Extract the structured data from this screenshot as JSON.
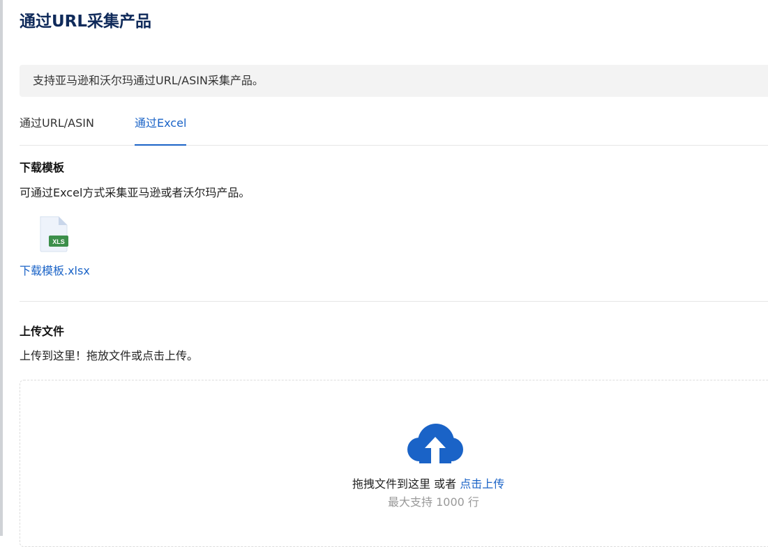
{
  "page": {
    "title": "通过URL采集产品"
  },
  "banner": {
    "text": "支持亚马逊和沃尔玛通过URL/ASIN采集产品。"
  },
  "tabs": [
    {
      "label": "通过URL/ASIN",
      "active": false
    },
    {
      "label": "通过Excel",
      "active": true
    }
  ],
  "download_section": {
    "title": "下载模板",
    "description": "可通过Excel方式采集亚马逊或者沃尔玛产品。",
    "file_icon": "xls-file-icon",
    "file_icon_badge": "XLS",
    "file_name": "下载模板.xlsx"
  },
  "upload_section": {
    "title": "上传文件",
    "description": "上传到这里！拖放文件或点击上传。",
    "dropzone": {
      "icon": "cloud-upload-icon",
      "prompt": "拖拽文件到这里 或者 ",
      "link_label": "点击上传",
      "limit_text": "最大支持 1000 行"
    }
  },
  "colors": {
    "accent": "#1a63c7",
    "title": "#0f2a5a",
    "banner_bg": "#f3f3f3",
    "muted": "#999999"
  }
}
